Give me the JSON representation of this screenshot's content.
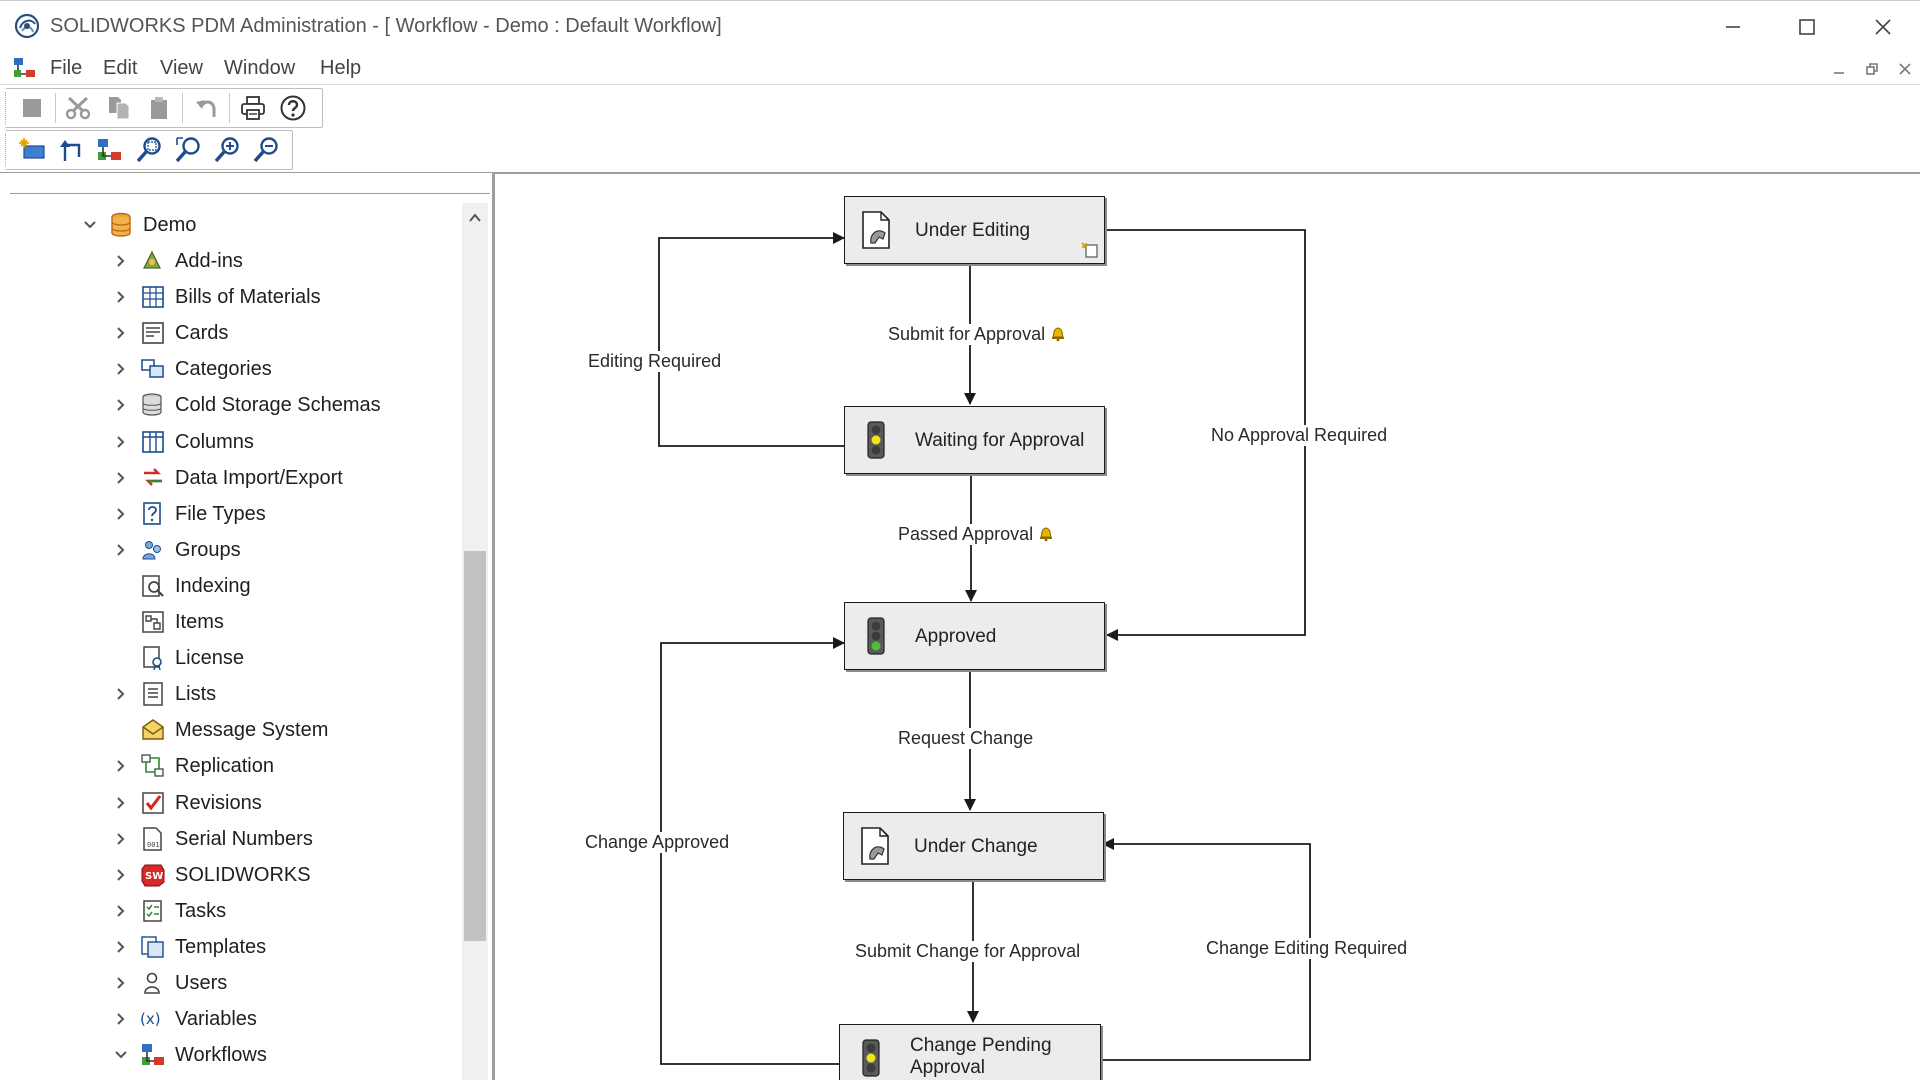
{
  "window": {
    "title": "SOLIDWORKS PDM Administration - [ Workflow - Demo : Default Workflow]"
  },
  "menu": {
    "items": [
      "File",
      "Edit",
      "View",
      "Window",
      "Help"
    ]
  },
  "toolbar": {
    "row1": [
      "stop-icon",
      "cut-icon",
      "copy-icon",
      "paste-icon",
      "undo-icon",
      "print-icon",
      "help-icon"
    ],
    "row2": [
      "new-state-icon",
      "new-transition-icon",
      "workflow-link-icon",
      "zoom-area-icon",
      "zoom-fit-icon",
      "zoom-in-icon",
      "zoom-out-icon"
    ]
  },
  "tree": {
    "root": "Demo",
    "items": [
      {
        "label": "Add-ins",
        "icon": "addins-icon",
        "expandable": true
      },
      {
        "label": "Bills of Materials",
        "icon": "bom-icon",
        "expandable": true
      },
      {
        "label": "Cards",
        "icon": "cards-icon",
        "expandable": true
      },
      {
        "label": "Categories",
        "icon": "categories-icon",
        "expandable": true
      },
      {
        "label": "Cold Storage Schemas",
        "icon": "cold-storage-icon",
        "expandable": true
      },
      {
        "label": "Columns",
        "icon": "columns-icon",
        "expandable": true
      },
      {
        "label": "Data Import/Export",
        "icon": "import-export-icon",
        "expandable": true
      },
      {
        "label": "File Types",
        "icon": "file-types-icon",
        "expandable": true
      },
      {
        "label": "Groups",
        "icon": "groups-icon",
        "expandable": true
      },
      {
        "label": "Indexing",
        "icon": "indexing-icon",
        "expandable": false
      },
      {
        "label": "Items",
        "icon": "items-icon",
        "expandable": false
      },
      {
        "label": "License",
        "icon": "license-icon",
        "expandable": false
      },
      {
        "label": "Lists",
        "icon": "lists-icon",
        "expandable": true
      },
      {
        "label": "Message System",
        "icon": "message-system-icon",
        "expandable": false
      },
      {
        "label": "Replication",
        "icon": "replication-icon",
        "expandable": true
      },
      {
        "label": "Revisions",
        "icon": "revisions-icon",
        "expandable": true
      },
      {
        "label": "Serial Numbers",
        "icon": "serial-numbers-icon",
        "expandable": true
      },
      {
        "label": "SOLIDWORKS",
        "icon": "solidworks-icon",
        "expandable": true
      },
      {
        "label": "Tasks",
        "icon": "tasks-icon",
        "expandable": true
      },
      {
        "label": "Templates",
        "icon": "templates-icon",
        "expandable": true
      },
      {
        "label": "Users",
        "icon": "users-icon",
        "expandable": true
      },
      {
        "label": "Variables",
        "icon": "variables-icon",
        "expandable": true
      },
      {
        "label": "Workflows",
        "icon": "workflows-icon",
        "expandable": true,
        "expanded": true
      }
    ]
  },
  "workflow": {
    "states": {
      "under_editing": "Under Editing",
      "waiting_for_approval": "Waiting for Approval",
      "approved": "Approved",
      "under_change": "Under Change",
      "change_pending_line1": "Change Pending",
      "change_pending_line2": "Approval"
    },
    "transitions": {
      "submit_for_approval": "Submit for Approval",
      "editing_required": "Editing Required",
      "passed_approval": "Passed Approval",
      "no_approval_required": "No Approval Required",
      "request_change": "Request Change",
      "change_approved": "Change Approved",
      "submit_change_for_approval": "Submit Change for Approval",
      "change_editing_required": "Change Editing Required"
    }
  },
  "colors": {
    "state_fill": "#ececec",
    "canvas": "#ffffff",
    "bell": "#e8b400",
    "light_yellow": "#f4e21a",
    "light_green": "#4fbf3a"
  }
}
